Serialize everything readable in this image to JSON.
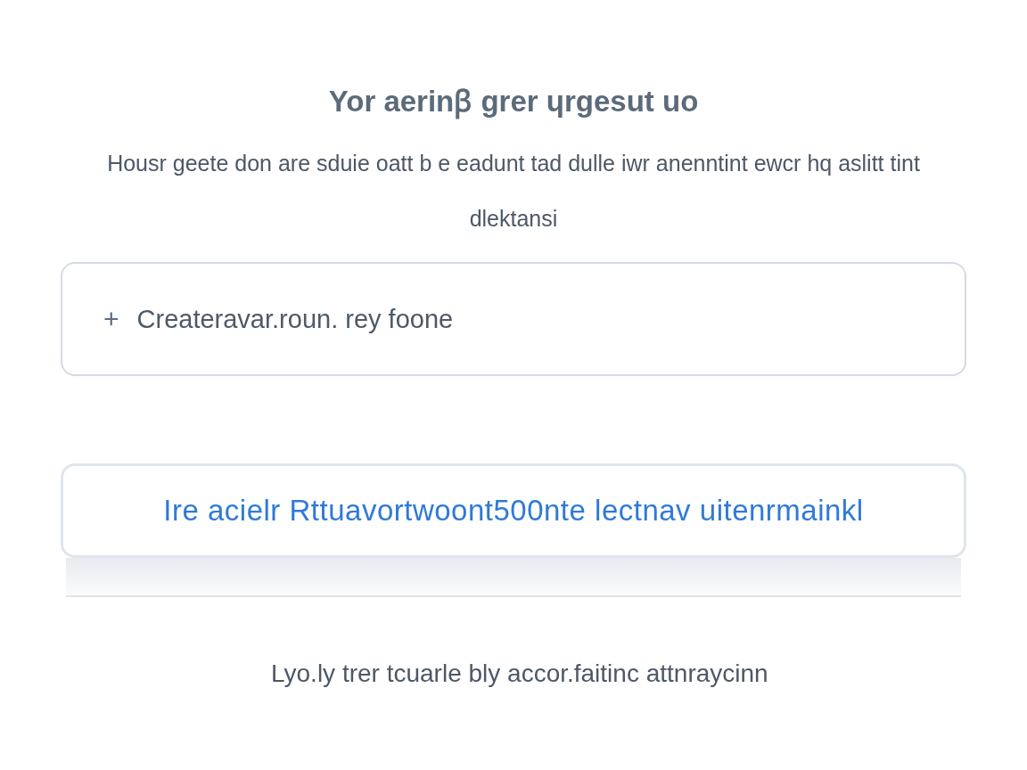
{
  "title": "Yor aerinꞵ grer ɥrgesut uo",
  "description": "Housr geete don are sduie oatt b e eadunt tad dulle iwr anenntint ewcr hq aslitt tint dlektansi",
  "create_button": {
    "icon": "+",
    "label": "Createravar.roun. rey foone"
  },
  "link_card": {
    "label": "Ire acielr Rttuavortwoont500nte lectnav uitenrmainkl"
  },
  "footer": "Lyo.ly trer tcuarle bly accor.faitinc attnraycinn"
}
